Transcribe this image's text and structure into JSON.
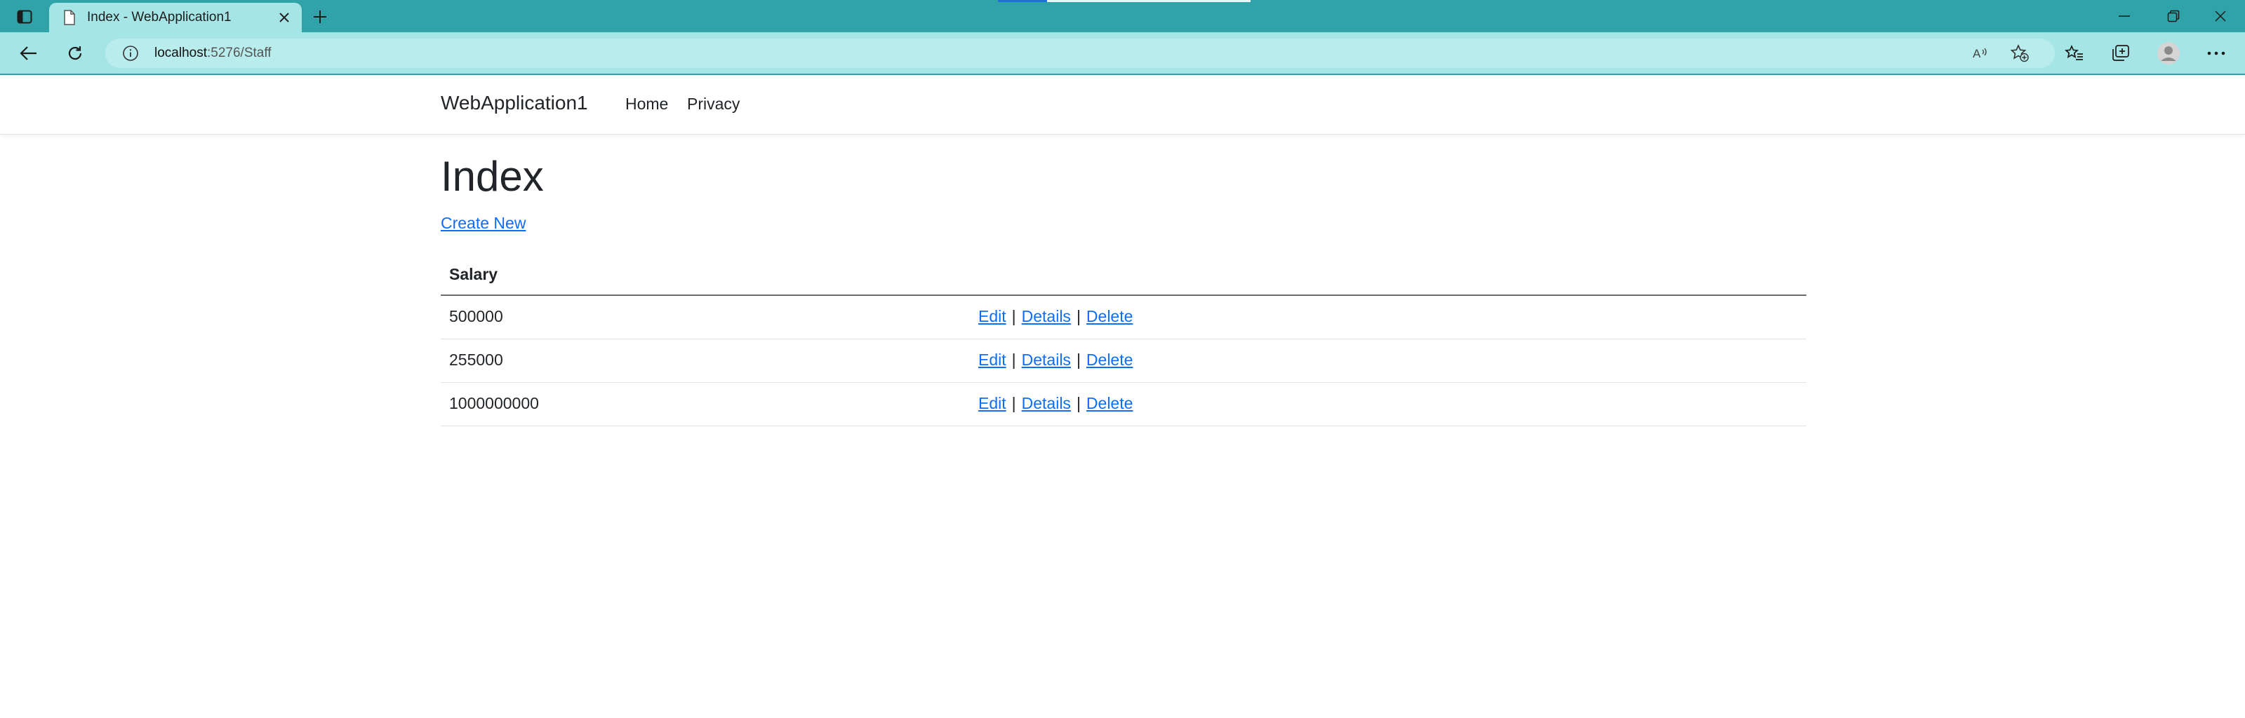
{
  "browser": {
    "tab_title": "Index - WebApplication1",
    "url_host": "localhost",
    "url_path": ":5276/Staff",
    "colors": {
      "titlebar": "#2fa3a7",
      "toolbar": "#a6e5e6",
      "link": "#0d6efd"
    },
    "icons": [
      "tab-actions-icon",
      "page-favicon-icon",
      "close-icon",
      "plus-icon",
      "back-arrow-icon",
      "refresh-icon",
      "info-icon",
      "read-aloud-icon",
      "add-favorite-icon",
      "favorites-icon",
      "collections-icon",
      "profile-icon",
      "more-icon",
      "minimize-icon",
      "restore-icon",
      "window-close-icon"
    ]
  },
  "navbar": {
    "brand": "WebApplication1",
    "links": [
      "Home",
      "Privacy"
    ]
  },
  "page": {
    "title": "Index",
    "create_link": "Create New",
    "table": {
      "header": "Salary",
      "rows": [
        {
          "salary": "500000"
        },
        {
          "salary": "255000"
        },
        {
          "salary": "1000000000"
        }
      ],
      "actions": {
        "edit": "Edit",
        "details": "Details",
        "delete": "Delete",
        "separator": "|"
      }
    }
  }
}
